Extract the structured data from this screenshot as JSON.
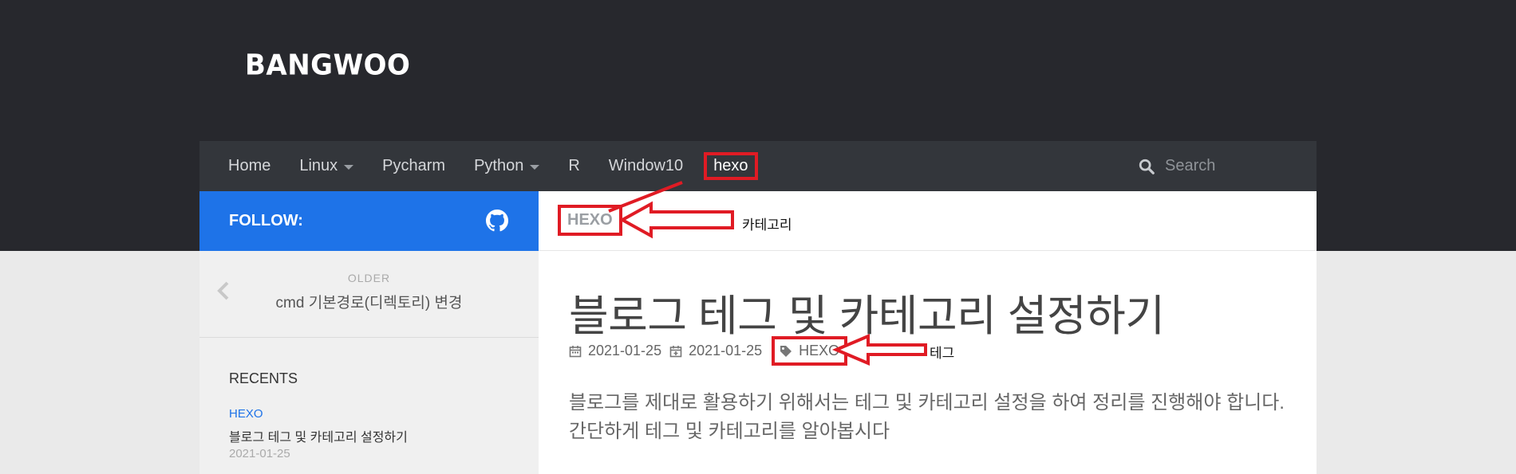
{
  "brand": {
    "logo": "BANGWOO"
  },
  "nav": {
    "items": [
      {
        "label": "Home",
        "has_dropdown": false
      },
      {
        "label": "Linux",
        "has_dropdown": true
      },
      {
        "label": "Pycharm",
        "has_dropdown": false
      },
      {
        "label": "Python",
        "has_dropdown": true
      },
      {
        "label": "R",
        "has_dropdown": false
      },
      {
        "label": "Window10",
        "has_dropdown": false
      },
      {
        "label": "hexo",
        "has_dropdown": false,
        "active": true
      }
    ],
    "search_placeholder": "Search"
  },
  "follow": {
    "label": "FOLLOW:",
    "icon": "github-icon"
  },
  "sidebar": {
    "older": {
      "label": "OLDER",
      "title": "cmd 기본경로(디렉토리) 변경"
    },
    "recents": {
      "heading": "RECENTS",
      "items": [
        {
          "category": "HEXO",
          "title": "블로그 테그 및 카테고리 설정하기",
          "date": "2021-01-25"
        }
      ]
    }
  },
  "breadcrumb": {
    "category": "HEXO"
  },
  "post": {
    "title": "블로그 테그 및 카테고리 설정하기",
    "date_published": "2021-01-25",
    "date_updated": "2021-01-25",
    "tag": "HEXO",
    "excerpt_line1": "블로그를 제대로 활용하기 위해서는 테그 및 카테고리 설정을 하여 정리를 진행해야 합니다.",
    "excerpt_line2": "간단하게 테그 및 카테고리를 알아봅시다"
  },
  "annotations": {
    "category_label": "카테고리",
    "tag_label": "테그",
    "color": "#e01b24"
  },
  "colors": {
    "header_bg": "#27282d",
    "nav_bg": "#33363b",
    "accent": "#1e73e8"
  }
}
